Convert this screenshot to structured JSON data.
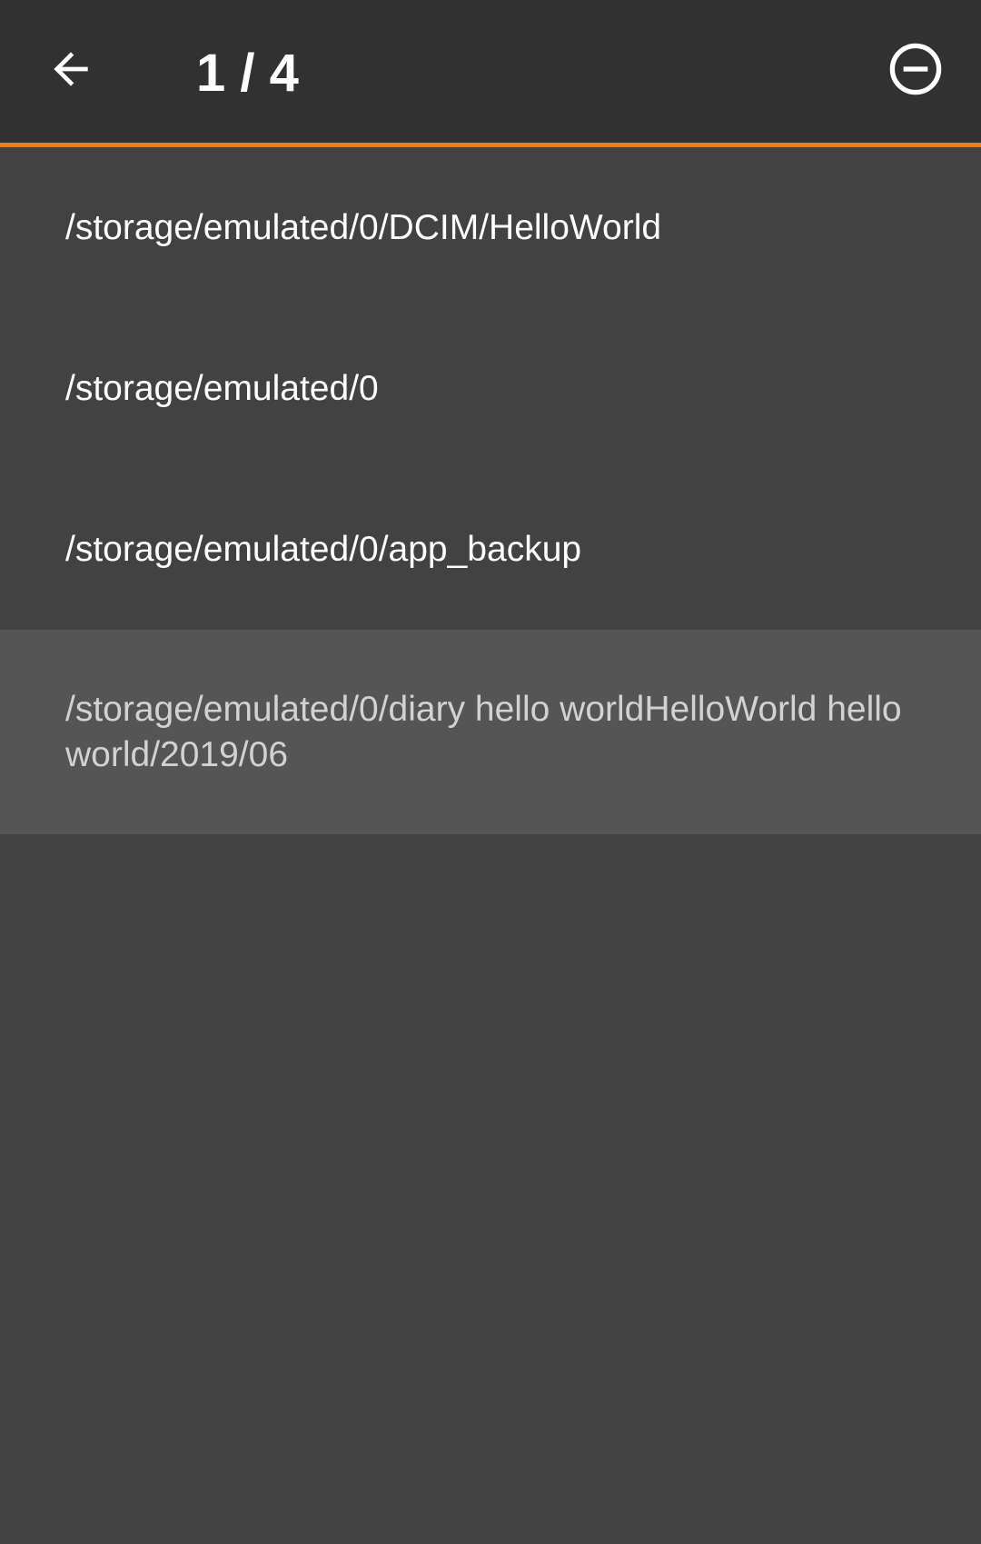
{
  "toolbar": {
    "title": "1 / 4",
    "back_icon": "arrow-left-icon",
    "remove_icon": "minus-circle-icon",
    "accent_color": "#f57c00"
  },
  "paths": [
    {
      "label": "/storage/emulated/0/DCIM/HelloWorld",
      "selected": false
    },
    {
      "label": "/storage/emulated/0",
      "selected": false
    },
    {
      "label": "/storage/emulated/0/app_backup",
      "selected": false
    },
    {
      "label": "/storage/emulated/0/diary hello worldHelloWorld hello world/2019/06",
      "selected": true
    }
  ]
}
